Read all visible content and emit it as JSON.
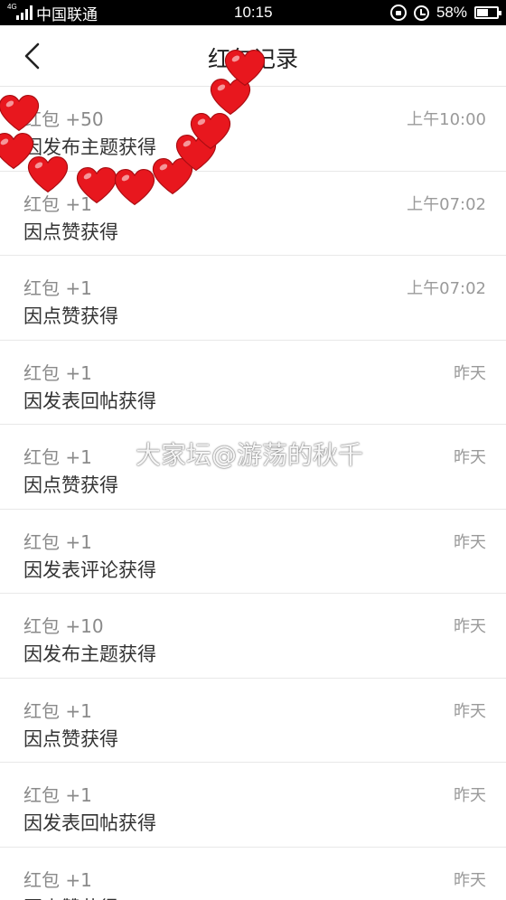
{
  "status_bar": {
    "network": "4G",
    "carrier": "中国联通",
    "time": "10:15",
    "battery": "58%",
    "battery_level": 0.58
  },
  "header": {
    "title": "红包记录"
  },
  "records": [
    {
      "amount": "红包 +50",
      "reason": "因发布主题获得",
      "time": "上午10:00"
    },
    {
      "amount": "红包 +1",
      "reason": "因点赞获得",
      "time": "上午07:02"
    },
    {
      "amount": "红包 +1",
      "reason": "因点赞获得",
      "time": "上午07:02"
    },
    {
      "amount": "红包 +1",
      "reason": "因发表回帖获得",
      "time": "昨天"
    },
    {
      "amount": "红包 +1",
      "reason": "因点赞获得",
      "time": "昨天"
    },
    {
      "amount": "红包 +1",
      "reason": "因发表评论获得",
      "time": "昨天"
    },
    {
      "amount": "红包 +10",
      "reason": "因发布主题获得",
      "time": "昨天"
    },
    {
      "amount": "红包 +1",
      "reason": "因点赞获得",
      "time": "昨天"
    },
    {
      "amount": "红包 +1",
      "reason": "因发表回帖获得",
      "time": "昨天"
    },
    {
      "amount": "红包 +1",
      "reason": "因点赞获得",
      "time": "昨天"
    }
  ],
  "watermark": "大家坛@游荡的秋千",
  "colors": {
    "heart": "#e8171e",
    "status_bar_bg": "#000000"
  }
}
